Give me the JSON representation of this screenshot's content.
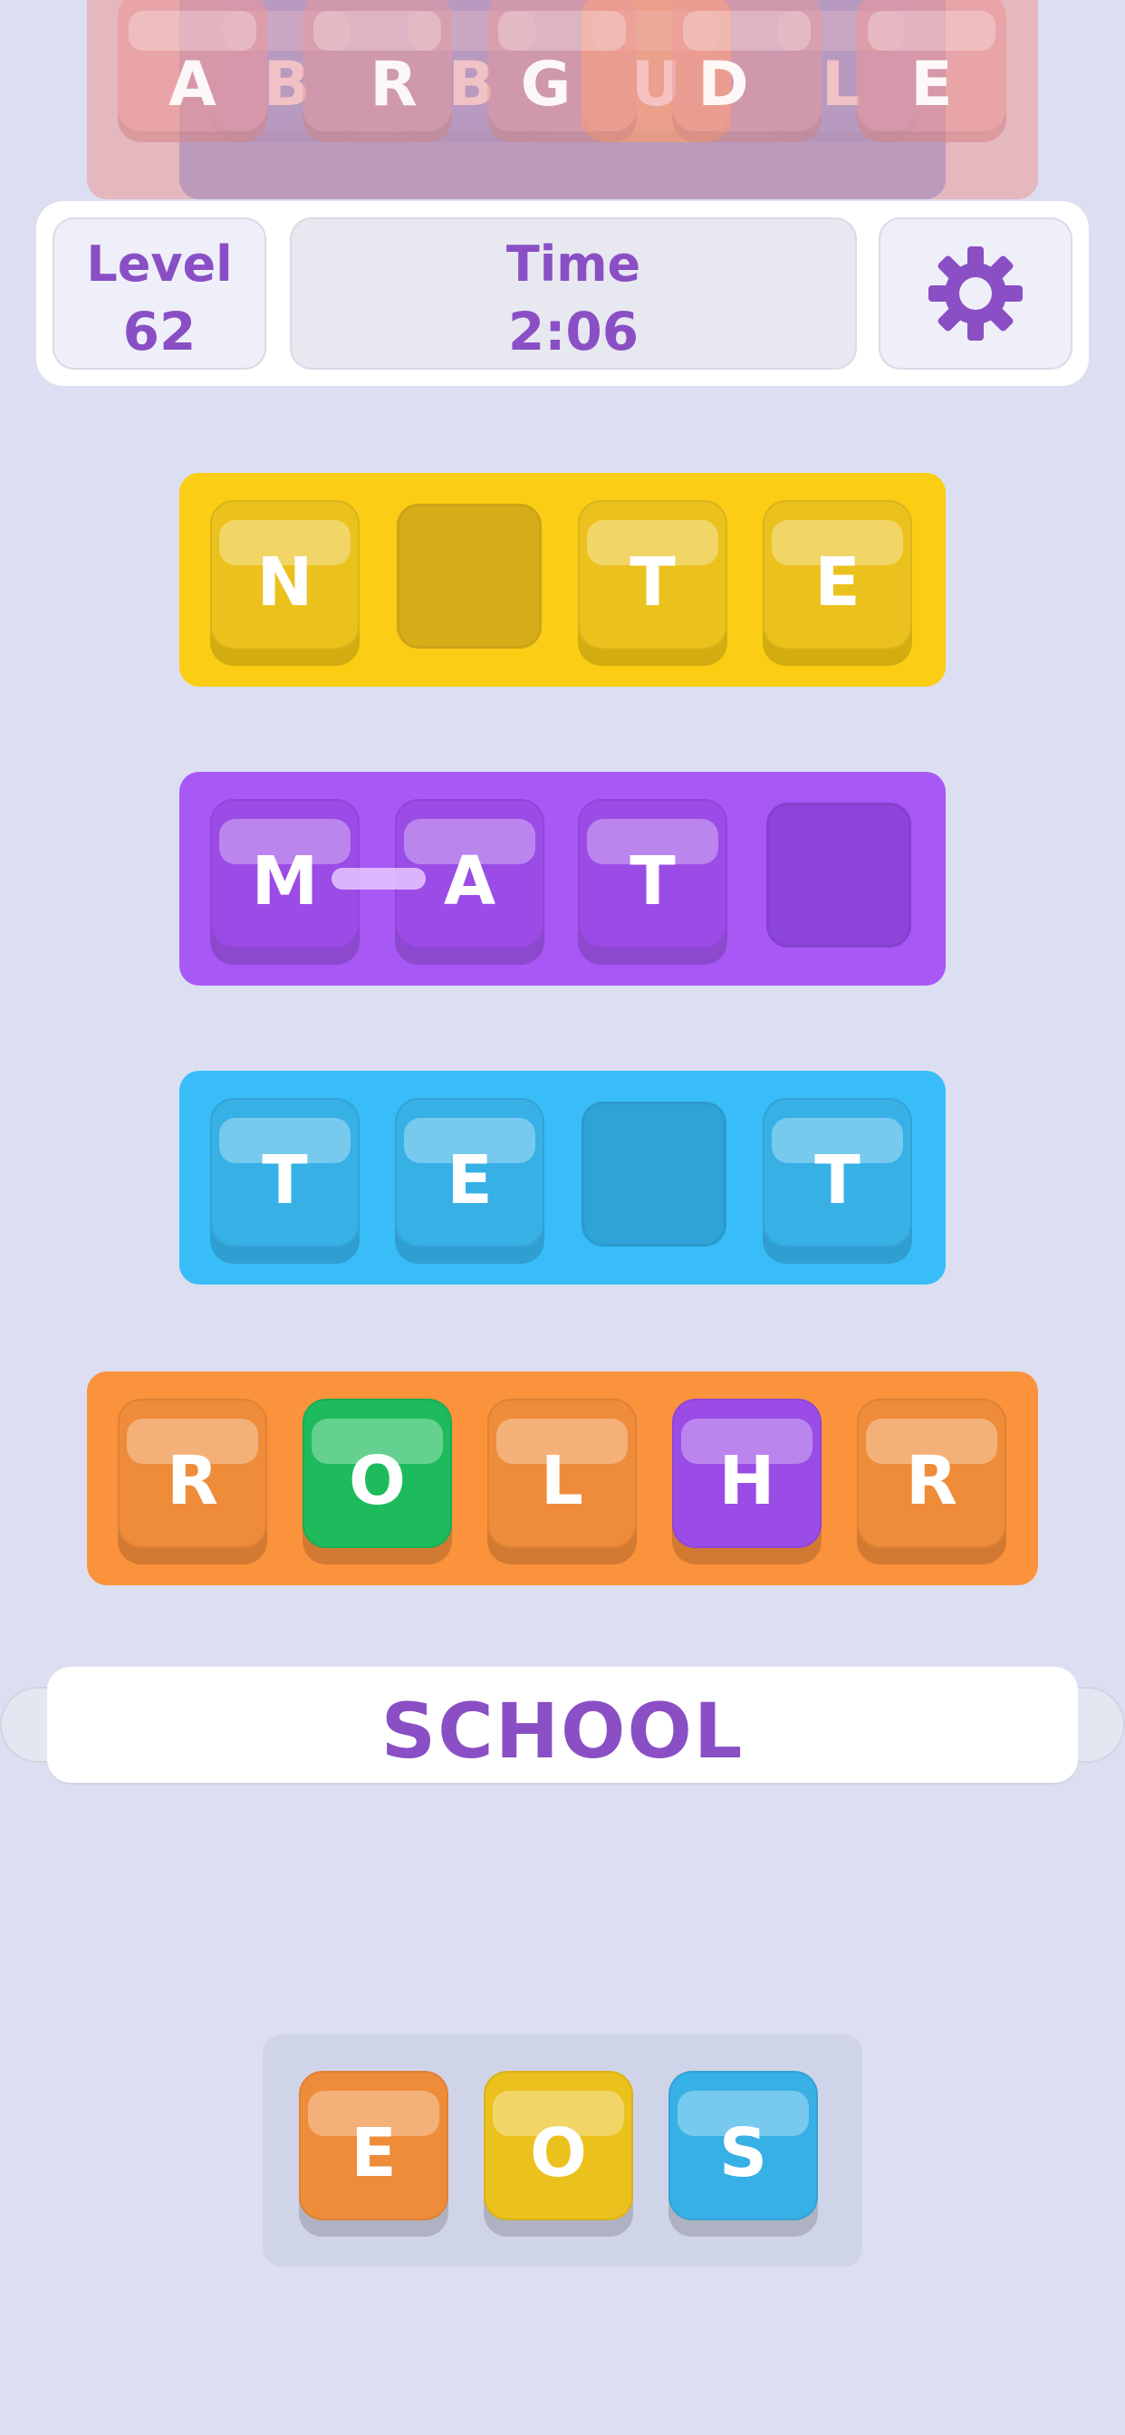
{
  "colors": {
    "background": "#dcdff1",
    "purple_text": "#8a4fc4",
    "yellow_row": "#fbcd14",
    "yellow_tile": "#ebc11e",
    "yellow_slot": "#d6ad19",
    "purple_row": "#a758f5",
    "purple_tile": "#9b4ce6",
    "purple_slot": "#8c45d8",
    "blue_row": "#38bdf8",
    "blue_tile": "#37b0e6",
    "blue_slot": "#2ea3d7",
    "orange_row": "#fb923c",
    "orange_tile": "#ee8c3a",
    "green_tile": "#1dbb5c"
  },
  "faded_rows": {
    "red_letters": [
      "A",
      "R",
      "G",
      "D",
      "E"
    ],
    "blue_letters": [
      "B",
      "B",
      "U",
      "L"
    ]
  },
  "header": {
    "level_label": "Level",
    "level_value": "62",
    "time_label": "Time",
    "time_value": "2:06",
    "settings_icon": "gear-icon"
  },
  "rows": [
    {
      "color": "yellow",
      "tiles": [
        "N",
        "",
        "T",
        "E"
      ]
    },
    {
      "color": "purple",
      "tiles": [
        "M",
        "A",
        "T",
        ""
      ]
    },
    {
      "color": "blue",
      "tiles": [
        "T",
        "E",
        "",
        "T"
      ]
    },
    {
      "color": "orange",
      "tiles": [
        "R",
        "O",
        "L",
        "H",
        "R"
      ],
      "highlights": [
        {
          "index": 1,
          "color": "green"
        },
        {
          "index": 3,
          "color": "purple"
        }
      ]
    }
  ],
  "word_banner": "SCHOOL",
  "tray": {
    "tiles": [
      "E",
      "O",
      "S"
    ],
    "tile_colors": [
      "orange",
      "yellow",
      "blue"
    ]
  }
}
